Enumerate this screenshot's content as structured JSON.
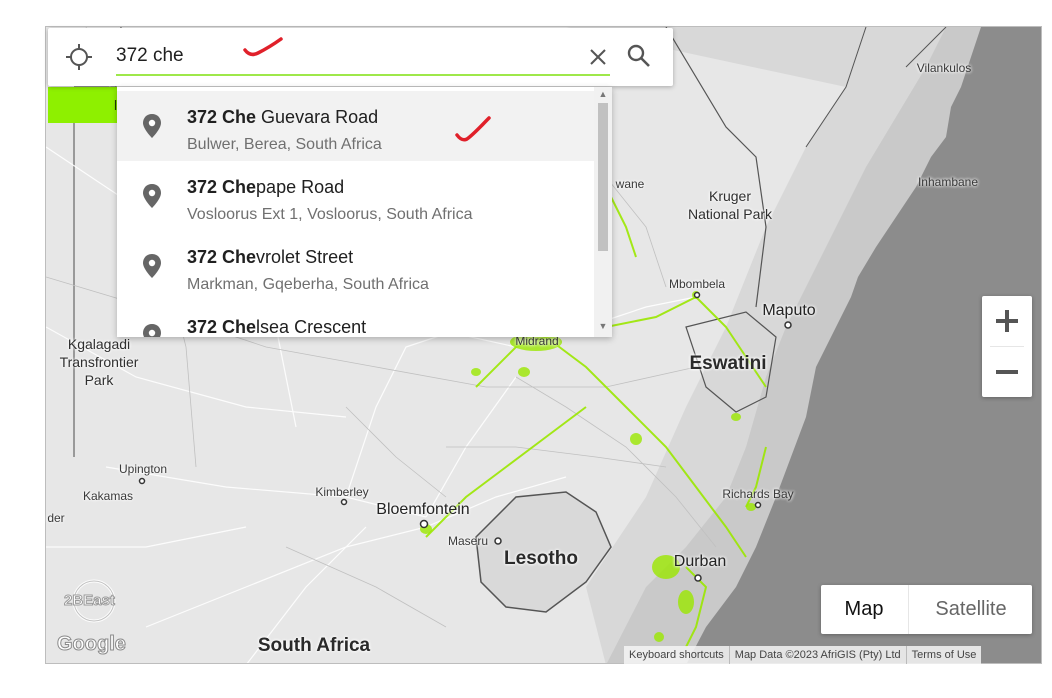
{
  "search": {
    "value": "372 che",
    "placeholder": ""
  },
  "suggestions": [
    {
      "match": "372 Che",
      "rest": " Guevara Road",
      "sub": "Bulwer, Berea, South Africa"
    },
    {
      "match": "372 Che",
      "rest": "pape Road",
      "sub": "Vosloorus Ext 1, Vosloorus, South Africa"
    },
    {
      "match": "372 Che",
      "rest": "vrolet Street",
      "sub": "Markman, Gqeberha, South Africa"
    },
    {
      "match": "372 Che",
      "rest": "lsea Crescent",
      "sub": ""
    }
  ],
  "green_band_text": "l",
  "map_labels": {
    "vilankulos": "Vilankulos",
    "inhambane": "Inhambane",
    "kruger": "Kruger\nNational Park",
    "wane": "wane",
    "mbombela": "Mbombela",
    "maputo": "Maputo",
    "eswatini": "Eswatini",
    "midrand": "Midrand",
    "kgalagadi": "Kgalagadi\nTransfrontier\nPark",
    "upington": "Upington",
    "kakamas": "Kakamas",
    "der": "der",
    "kimberley": "Kimberley",
    "bloemfontein": "Bloemfontein",
    "maseru": "Maseru",
    "lesotho": "Lesotho",
    "richards_bay": "Richards Bay",
    "durban": "Durban",
    "south_africa": "South Africa"
  },
  "controls": {
    "zoom_in": "+",
    "zoom_out": "−",
    "map_type_map": "Map",
    "map_type_satellite": "Satellite"
  },
  "footer": {
    "shortcuts": "Keyboard shortcuts",
    "map_data": "Map Data ©2023 AfriGIS (Pty) Ltd",
    "terms": "Terms of Use"
  },
  "branding": {
    "google": "Google",
    "watermark": "2BEast"
  },
  "colors": {
    "accent_green": "#8ef000",
    "underline_green": "#9ee84a",
    "ocean": "#8c8c8c",
    "land": "#e6e6e6",
    "annotation_red": "#e0202a"
  }
}
